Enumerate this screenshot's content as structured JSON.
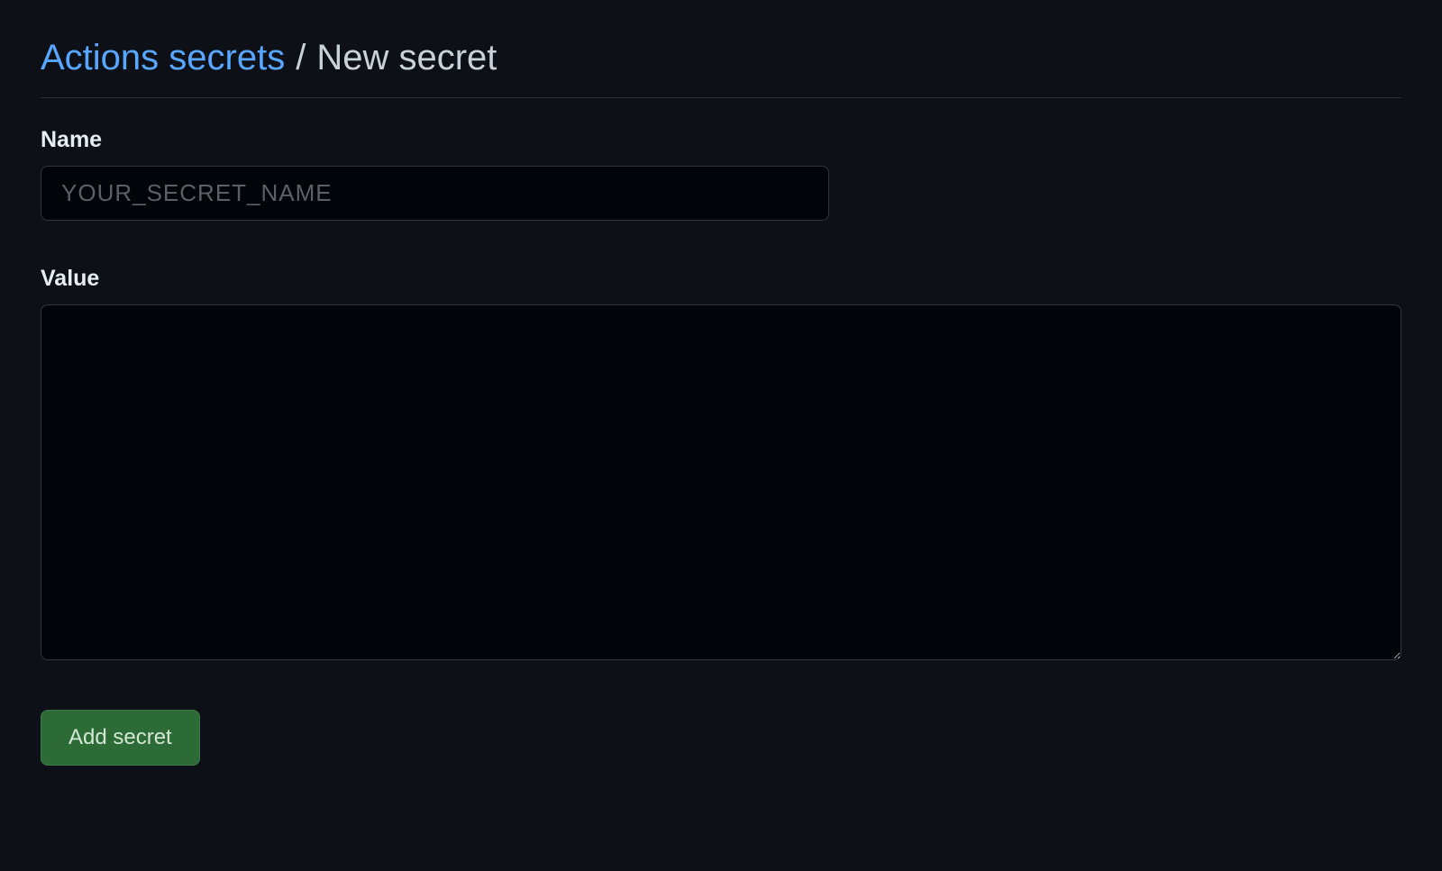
{
  "header": {
    "breadcrumb_link": "Actions secrets",
    "breadcrumb_separator": "/",
    "breadcrumb_current": "New secret"
  },
  "form": {
    "name_label": "Name",
    "name_placeholder": "YOUR_SECRET_NAME",
    "name_value": "",
    "value_label": "Value",
    "value_content": ""
  },
  "actions": {
    "submit_label": "Add secret"
  },
  "colors": {
    "background": "#0d1117",
    "input_background": "#010409",
    "border": "#30363d",
    "text": "#c9d1d9",
    "link": "#58a6ff",
    "button": "#2c6a36"
  }
}
